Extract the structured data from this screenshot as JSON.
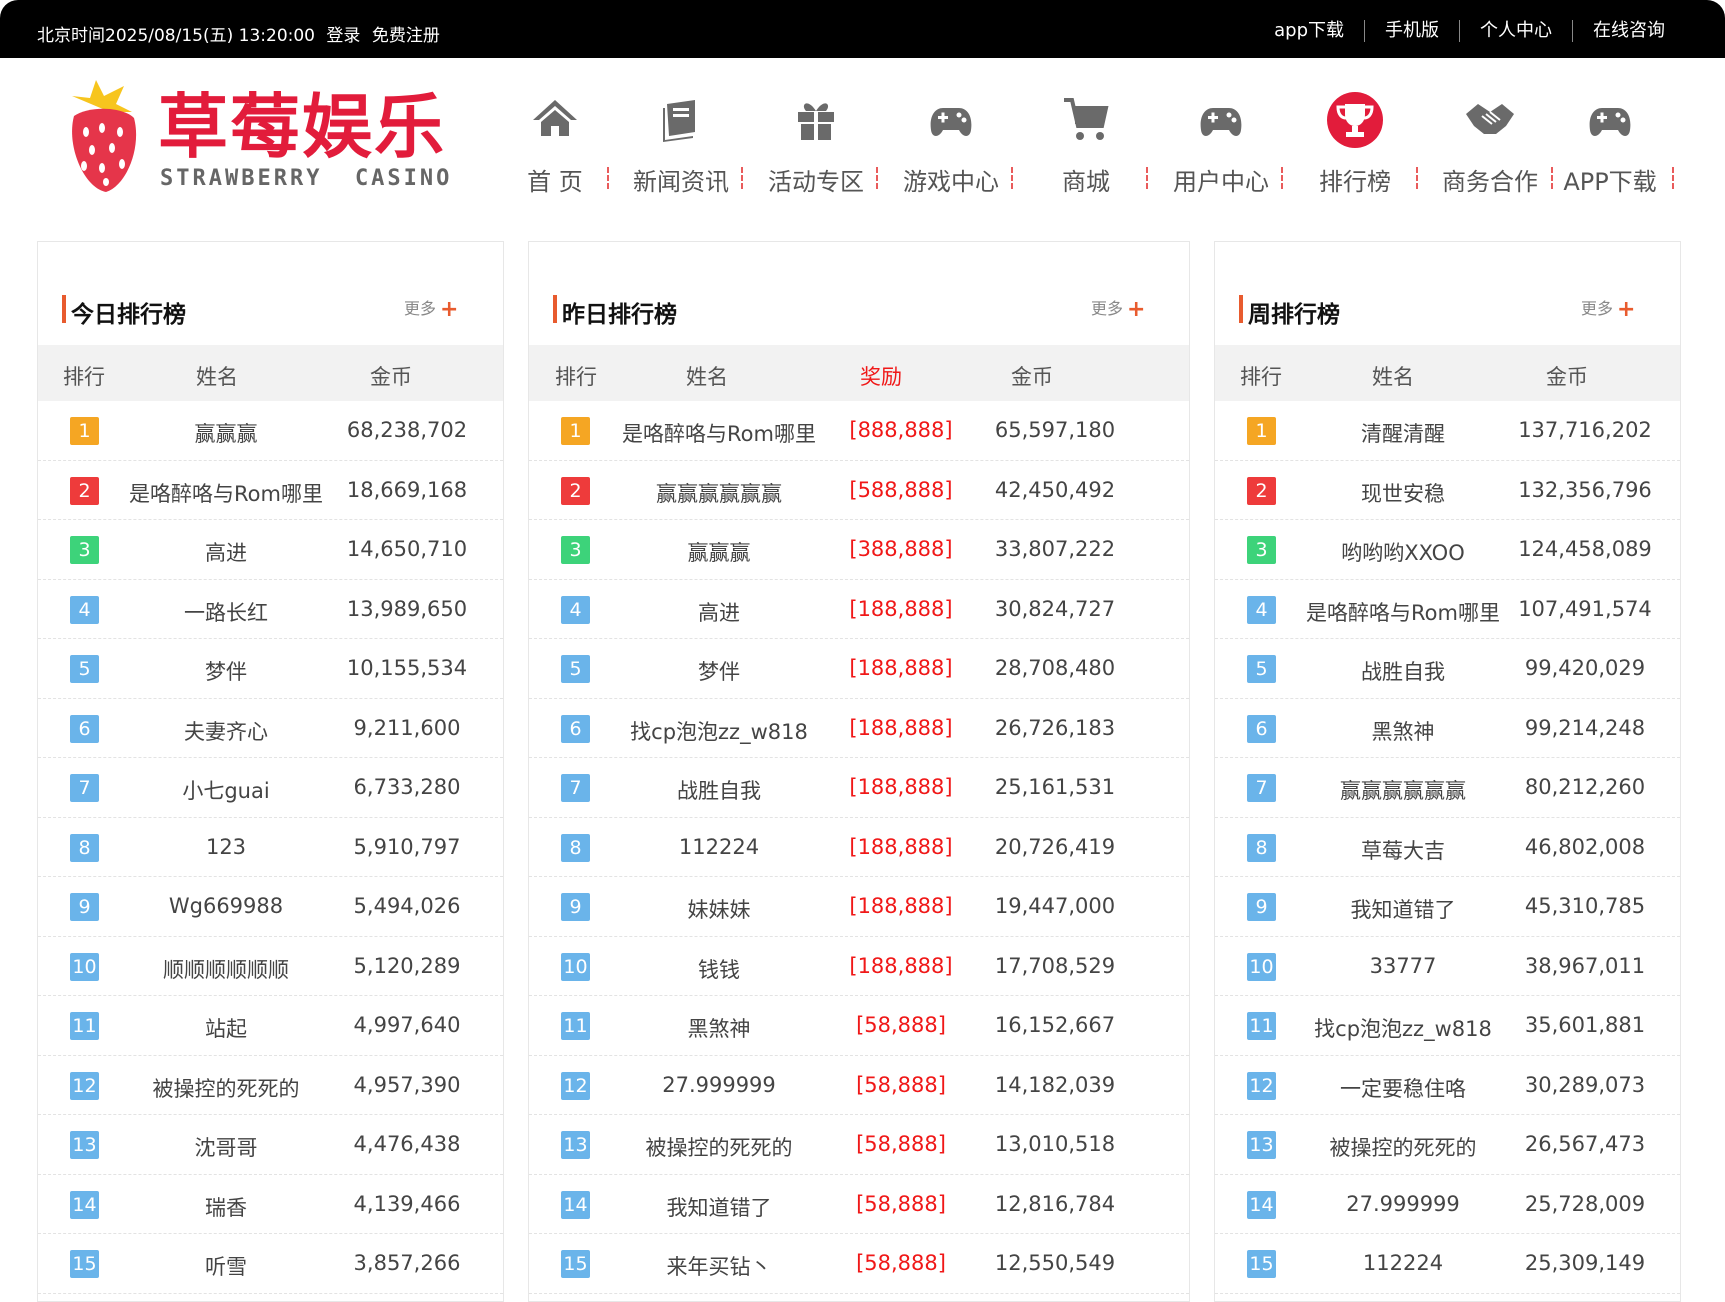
{
  "topbar": {
    "datetime": "北京时间2025/08/15(五) 13:20:00",
    "login": "登录",
    "register": "免费注册",
    "links": [
      "app下载",
      "手机版",
      "个人中心",
      "在线咨询"
    ]
  },
  "logo": {
    "cn": "草莓娱乐",
    "en": "STRAWBERRY  CASINO"
  },
  "nav": [
    {
      "label": "首 页",
      "icon": "home-icon"
    },
    {
      "label": "新闻资讯",
      "icon": "book-icon"
    },
    {
      "label": "活动专区",
      "icon": "gift-icon"
    },
    {
      "label": "游戏中心",
      "icon": "gamepad-icon"
    },
    {
      "label": "商城",
      "icon": "cart-icon"
    },
    {
      "label": "用户中心",
      "icon": "gamepad-icon"
    },
    {
      "label": "排行榜",
      "icon": "trophy-icon",
      "active": true
    },
    {
      "label": "商务合作",
      "icon": "handshake-icon"
    },
    {
      "label": "APP下载",
      "icon": "gamepad-icon"
    }
  ],
  "colors": {
    "accent": "#e21c3b",
    "reward": "#f01818",
    "rank1": "#f5a623",
    "rank2": "#ee3b3b",
    "rank3": "#3dd37a",
    "rankN": "#6ab4ea"
  },
  "panels": [
    {
      "title": "今日排行榜",
      "more": "更多",
      "headers": [
        "排行",
        "姓名",
        "金币"
      ],
      "rows": [
        {
          "rank": "1",
          "name": "赢赢赢",
          "coins": "68,238,702"
        },
        {
          "rank": "2",
          "name": "是咯醉咯与Rom哪里",
          "coins": "18,669,168"
        },
        {
          "rank": "3",
          "name": "高进",
          "coins": "14,650,710"
        },
        {
          "rank": "4",
          "name": "一路长红",
          "coins": "13,989,650"
        },
        {
          "rank": "5",
          "name": "梦伴",
          "coins": "10,155,534"
        },
        {
          "rank": "6",
          "name": "夫妻齐心",
          "coins": "9,211,600"
        },
        {
          "rank": "7",
          "name": "小七guai",
          "coins": "6,733,280"
        },
        {
          "rank": "8",
          "name": "123",
          "coins": "5,910,797"
        },
        {
          "rank": "9",
          "name": "Wg669988",
          "coins": "5,494,026"
        },
        {
          "rank": "10",
          "name": "顺顺顺顺顺顺",
          "coins": "5,120,289"
        },
        {
          "rank": "11",
          "name": "站起",
          "coins": "4,997,640"
        },
        {
          "rank": "12",
          "name": "被操控的死死的",
          "coins": "4,957,390"
        },
        {
          "rank": "13",
          "name": "沈哥哥",
          "coins": "4,476,438"
        },
        {
          "rank": "14",
          "name": "瑞香",
          "coins": "4,139,466"
        },
        {
          "rank": "15",
          "name": "听雪",
          "coins": "3,857,266"
        }
      ]
    },
    {
      "title": "昨日排行榜",
      "more": "更多",
      "headers": [
        "排行",
        "姓名",
        "奖励",
        "金币"
      ],
      "rows": [
        {
          "rank": "1",
          "name": "是咯醉咯与Rom哪里",
          "reward": "[888,888]",
          "coins": "65,597,180"
        },
        {
          "rank": "2",
          "name": "赢赢赢赢赢赢",
          "reward": "[588,888]",
          "coins": "42,450,492"
        },
        {
          "rank": "3",
          "name": "赢赢赢",
          "reward": "[388,888]",
          "coins": "33,807,222"
        },
        {
          "rank": "4",
          "name": "高进",
          "reward": "[188,888]",
          "coins": "30,824,727"
        },
        {
          "rank": "5",
          "name": "梦伴",
          "reward": "[188,888]",
          "coins": "28,708,480"
        },
        {
          "rank": "6",
          "name": "找cp泡泡zz_w818",
          "reward": "[188,888]",
          "coins": "26,726,183"
        },
        {
          "rank": "7",
          "name": "战胜自我",
          "reward": "[188,888]",
          "coins": "25,161,531"
        },
        {
          "rank": "8",
          "name": "112224",
          "reward": "[188,888]",
          "coins": "20,726,419"
        },
        {
          "rank": "9",
          "name": "妹妹妹",
          "reward": "[188,888]",
          "coins": "19,447,000"
        },
        {
          "rank": "10",
          "name": "钱钱",
          "reward": "[188,888]",
          "coins": "17,708,529"
        },
        {
          "rank": "11",
          "name": "黑煞神",
          "reward": "[58,888]",
          "coins": "16,152,667"
        },
        {
          "rank": "12",
          "name": "27.999999",
          "reward": "[58,888]",
          "coins": "14,182,039"
        },
        {
          "rank": "13",
          "name": "被操控的死死的",
          "reward": "[58,888]",
          "coins": "13,010,518"
        },
        {
          "rank": "14",
          "name": "我知道错了",
          "reward": "[58,888]",
          "coins": "12,816,784"
        },
        {
          "rank": "15",
          "name": "来年买钻丶",
          "reward": "[58,888]",
          "coins": "12,550,549"
        }
      ]
    },
    {
      "title": "周排行榜",
      "more": "更多",
      "headers": [
        "排行",
        "姓名",
        "金币"
      ],
      "rows": [
        {
          "rank": "1",
          "name": "清醒清醒",
          "coins": "137,716,202"
        },
        {
          "rank": "2",
          "name": "现世安稳",
          "coins": "132,356,796"
        },
        {
          "rank": "3",
          "name": "哟哟哟XXOO",
          "coins": "124,458,089"
        },
        {
          "rank": "4",
          "name": "是咯醉咯与Rom哪里",
          "coins": "107,491,574"
        },
        {
          "rank": "5",
          "name": "战胜自我",
          "coins": "99,420,029"
        },
        {
          "rank": "6",
          "name": "黑煞神",
          "coins": "99,214,248"
        },
        {
          "rank": "7",
          "name": "赢赢赢赢赢赢",
          "coins": "80,212,260"
        },
        {
          "rank": "8",
          "name": "草莓大吉",
          "coins": "46,802,008"
        },
        {
          "rank": "9",
          "name": "我知道错了",
          "coins": "45,310,785"
        },
        {
          "rank": "10",
          "name": "33777",
          "coins": "38,967,011"
        },
        {
          "rank": "11",
          "name": "找cp泡泡zz_w818",
          "coins": "35,601,881"
        },
        {
          "rank": "12",
          "name": "一定要稳住咯",
          "coins": "30,289,073"
        },
        {
          "rank": "13",
          "name": "被操控的死死的",
          "coins": "26,567,473"
        },
        {
          "rank": "14",
          "name": "27.999999",
          "coins": "25,728,009"
        },
        {
          "rank": "15",
          "name": "112224",
          "coins": "25,309,149"
        }
      ]
    }
  ]
}
